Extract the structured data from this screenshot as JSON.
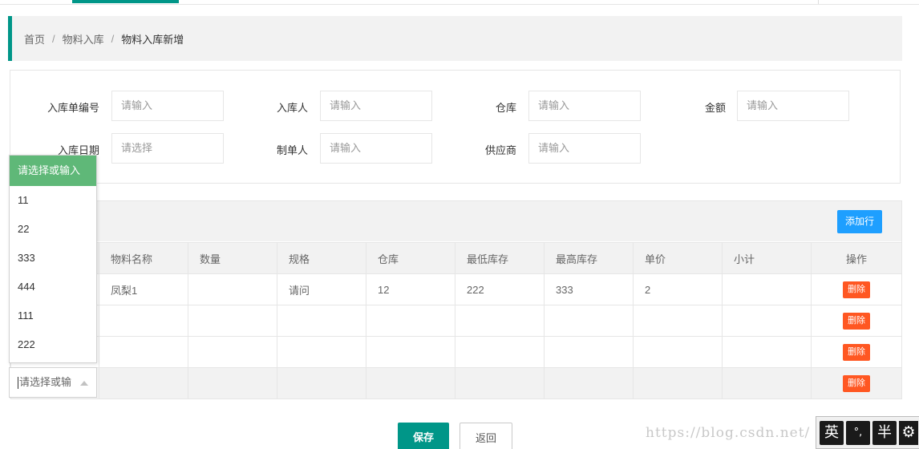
{
  "breadcrumb": [
    "首页",
    "物料入库",
    "物料入库新增"
  ],
  "breadcrumb_separator": "/",
  "form": {
    "row1": [
      {
        "label": "入库单编号",
        "placeholder": "请输入"
      },
      {
        "label": "入库人",
        "placeholder": "请输入"
      },
      {
        "label": "仓库",
        "placeholder": "请输入"
      },
      {
        "label": "金额",
        "placeholder": "请输入"
      }
    ],
    "row2": [
      {
        "label": "入库日期",
        "placeholder": "请选择"
      },
      {
        "label": "制单人",
        "placeholder": "请输入"
      },
      {
        "label": "供应商",
        "placeholder": "请输入"
      }
    ]
  },
  "table": {
    "add_row_label": "添加行",
    "headers": [
      "物料名称",
      "数量",
      "规格",
      "仓库",
      "最低库存",
      "最高库存",
      "单价",
      "小计",
      "操作"
    ],
    "rows": [
      {
        "name": "凤梨1",
        "qty": "",
        "spec": "请问",
        "warehouse": "12",
        "min": "222",
        "max": "333",
        "price": "2",
        "subtotal": "",
        "action": "删除"
      },
      {
        "name": "",
        "qty": "",
        "spec": "",
        "warehouse": "",
        "min": "",
        "max": "",
        "price": "",
        "subtotal": "",
        "action": "删除"
      },
      {
        "name": "",
        "qty": "",
        "spec": "",
        "warehouse": "",
        "min": "",
        "max": "",
        "price": "",
        "subtotal": "",
        "action": "删除"
      },
      {
        "name": "",
        "qty": "",
        "spec": "",
        "warehouse": "",
        "min": "",
        "max": "",
        "price": "",
        "subtotal": "",
        "action": "删除"
      }
    ]
  },
  "dropdown": {
    "header": "请选择或输入",
    "options": [
      "11",
      "22",
      "333",
      "444",
      "111",
      "222"
    ],
    "select_text": "请选择或输"
  },
  "buttons": {
    "save": "保存",
    "back": "返回"
  },
  "watermark": "https://blog.csdn.net/  208",
  "ime": {
    "lang": "英",
    "punct": "°,",
    "width": "半",
    "settings_icon": "gear-icon"
  },
  "colors": {
    "primary": "#009688",
    "blue": "#1e9fff",
    "danger": "#ff5722",
    "dropdown_header": "#5fb878"
  }
}
